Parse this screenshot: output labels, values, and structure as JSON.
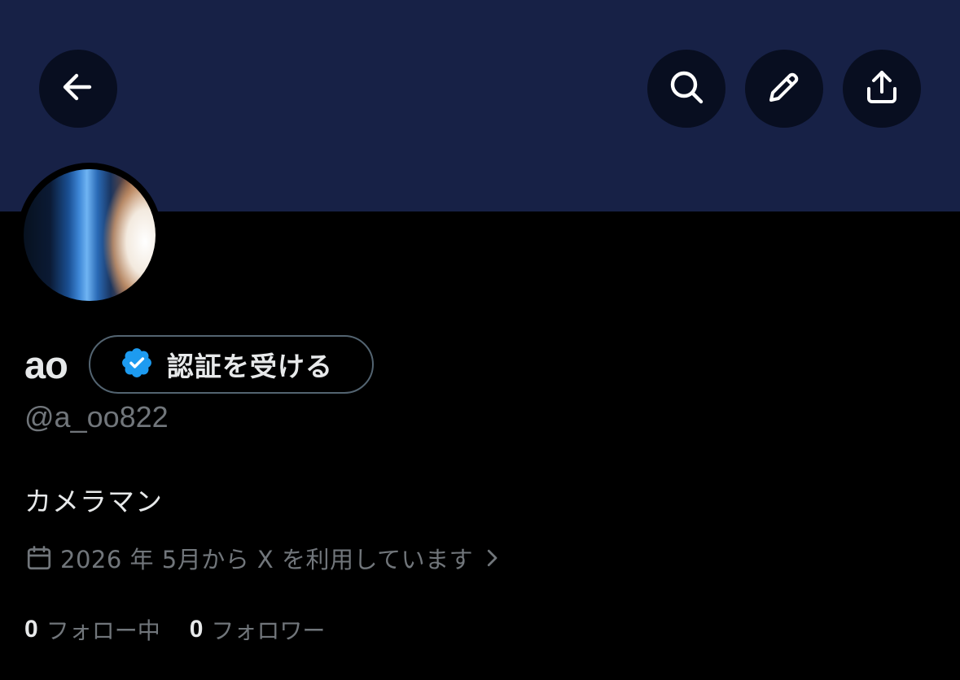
{
  "header": {
    "back_icon": "arrow-left-icon",
    "search_icon": "search-icon",
    "edit_icon": "pencil-icon",
    "share_icon": "share-upload-icon",
    "banner_color": "#172146"
  },
  "profile": {
    "display_name": "ao",
    "verify_button_label": "認証を受ける",
    "verify_icon": "verified-badge-icon",
    "handle": "@a_oo822",
    "bio": "カメラマン",
    "joined_text": "2026 年 5月から X を利用しています",
    "joined_icon": "calendar-icon"
  },
  "stats": {
    "following_count": "0",
    "following_label": "フォロー中",
    "followers_count": "0",
    "followers_label": "フォロワー"
  },
  "colors": {
    "background": "#000000",
    "primary_text": "#e7e9ea",
    "secondary_text": "#71767b",
    "verified_blue": "#1d9bf0"
  }
}
